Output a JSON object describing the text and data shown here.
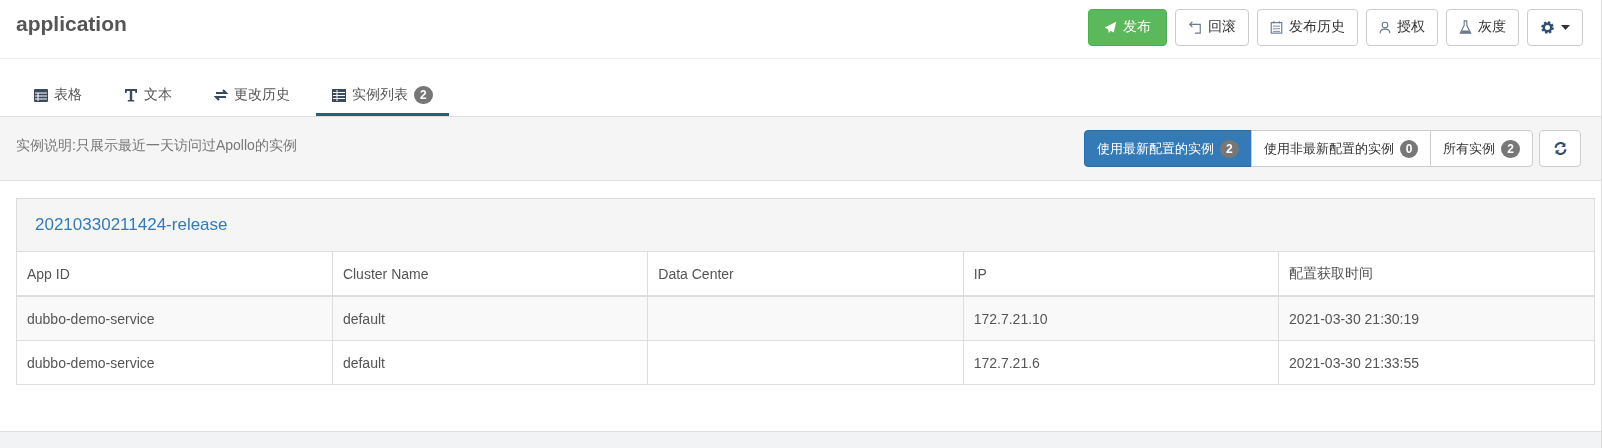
{
  "header": {
    "title": "application",
    "buttons": [
      {
        "kind": "primary",
        "label": "发布"
      },
      {
        "kind": "default",
        "label": "回滚"
      },
      {
        "kind": "default",
        "label": "发布历史"
      },
      {
        "kind": "default",
        "label": "授权"
      },
      {
        "kind": "default",
        "label": "灰度"
      },
      {
        "kind": "dropdown"
      }
    ]
  },
  "tabs": [
    {
      "label": "表格",
      "selected": false
    },
    {
      "label": "文本",
      "selected": false
    },
    {
      "label": "更改历史",
      "selected": false
    },
    {
      "label": "实例列表",
      "badge": "2",
      "selected": true
    }
  ],
  "filter_bar": {
    "note": "实例说明:只展示最近一天访问过Apollo的实例",
    "filters": [
      {
        "label": "使用最新配置的实例",
        "badge": "2",
        "selected": true
      },
      {
        "label": "使用非最新配置的实例",
        "badge": "0",
        "selected": false
      },
      {
        "label": "所有实例",
        "badge": "2",
        "selected": false
      }
    ]
  },
  "release": {
    "name": "20210330211424-release",
    "table": {
      "columns": [
        "App ID",
        "Cluster Name",
        "Data Center",
        "IP",
        "配置获取时间"
      ],
      "rows": [
        [
          "dubbo-demo-service",
          "default",
          "",
          "172.7.21.10",
          "2021-03-30 21:30:19"
        ],
        [
          "dubbo-demo-service",
          "default",
          "",
          "172.7.21.6",
          "2021-03-30 21:33:55"
        ]
      ]
    }
  }
}
